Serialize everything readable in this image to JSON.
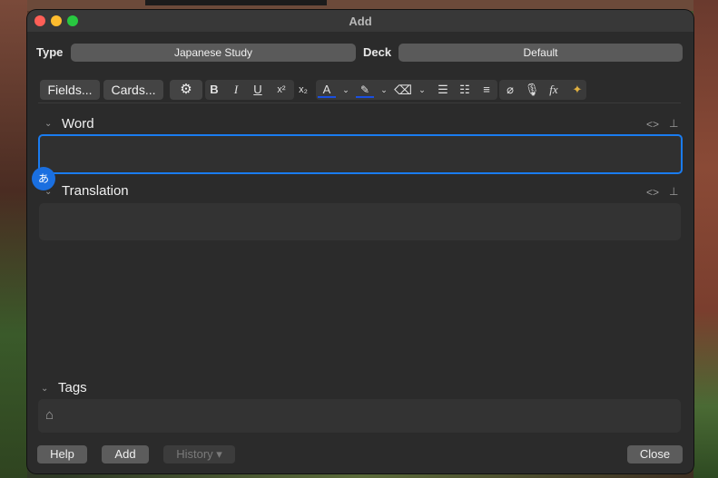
{
  "window": {
    "title": "Add"
  },
  "type": {
    "label": "Type",
    "value": "Japanese Study"
  },
  "deck": {
    "label": "Deck",
    "value": "Default"
  },
  "toolbar": {
    "fields_label": "Fields...",
    "cards_label": "Cards...",
    "bold": "B",
    "italic": "I",
    "underline": "U",
    "superscript": "x²",
    "subscript": "x₂",
    "text_color": "A",
    "mathjax": "fx"
  },
  "fields": [
    {
      "name": "Word",
      "value": ""
    },
    {
      "name": "Translation",
      "value": ""
    }
  ],
  "tags": {
    "label": "Tags"
  },
  "buttons": {
    "help": "Help",
    "add": "Add",
    "history": "History ▾",
    "close": "Close"
  },
  "colors": {
    "accent": "#1a7cf0"
  }
}
